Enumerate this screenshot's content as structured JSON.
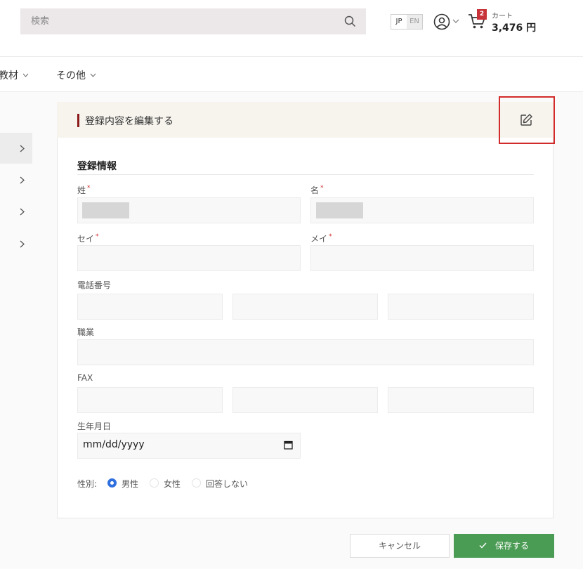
{
  "header": {
    "search_placeholder": "検索",
    "lang": {
      "jp": "JP",
      "en": "EN"
    },
    "cart": {
      "badge": "2",
      "label": "カート",
      "total": "3,476 円"
    }
  },
  "nav": {
    "items": [
      {
        "label": "教材"
      },
      {
        "label": "その他"
      }
    ]
  },
  "card": {
    "title": "登録内容を編集する",
    "section_title": "登録情報",
    "labels": {
      "sei": "姓",
      "mei": "名",
      "sei_kana": "セイ",
      "mei_kana": "メイ",
      "phone": "電話番号",
      "occupation": "職業",
      "fax": "FAX",
      "birthdate": "生年月日",
      "gender": "性別:"
    },
    "required_mark": "*",
    "birthdate_value": "mm/dd/yyyy",
    "gender_options": [
      {
        "label": "男性",
        "checked": true
      },
      {
        "label": "女性",
        "checked": false
      },
      {
        "label": "回答しない",
        "checked": false
      }
    ]
  },
  "buttons": {
    "cancel": "キャンセル",
    "save": "保存する"
  },
  "colors": {
    "accent_red": "#d22b2b",
    "title_bar": "#8b1a1a",
    "save_green": "#4a9b53",
    "radio_blue": "#2f6fde",
    "cart_badge": "#c8333a"
  }
}
